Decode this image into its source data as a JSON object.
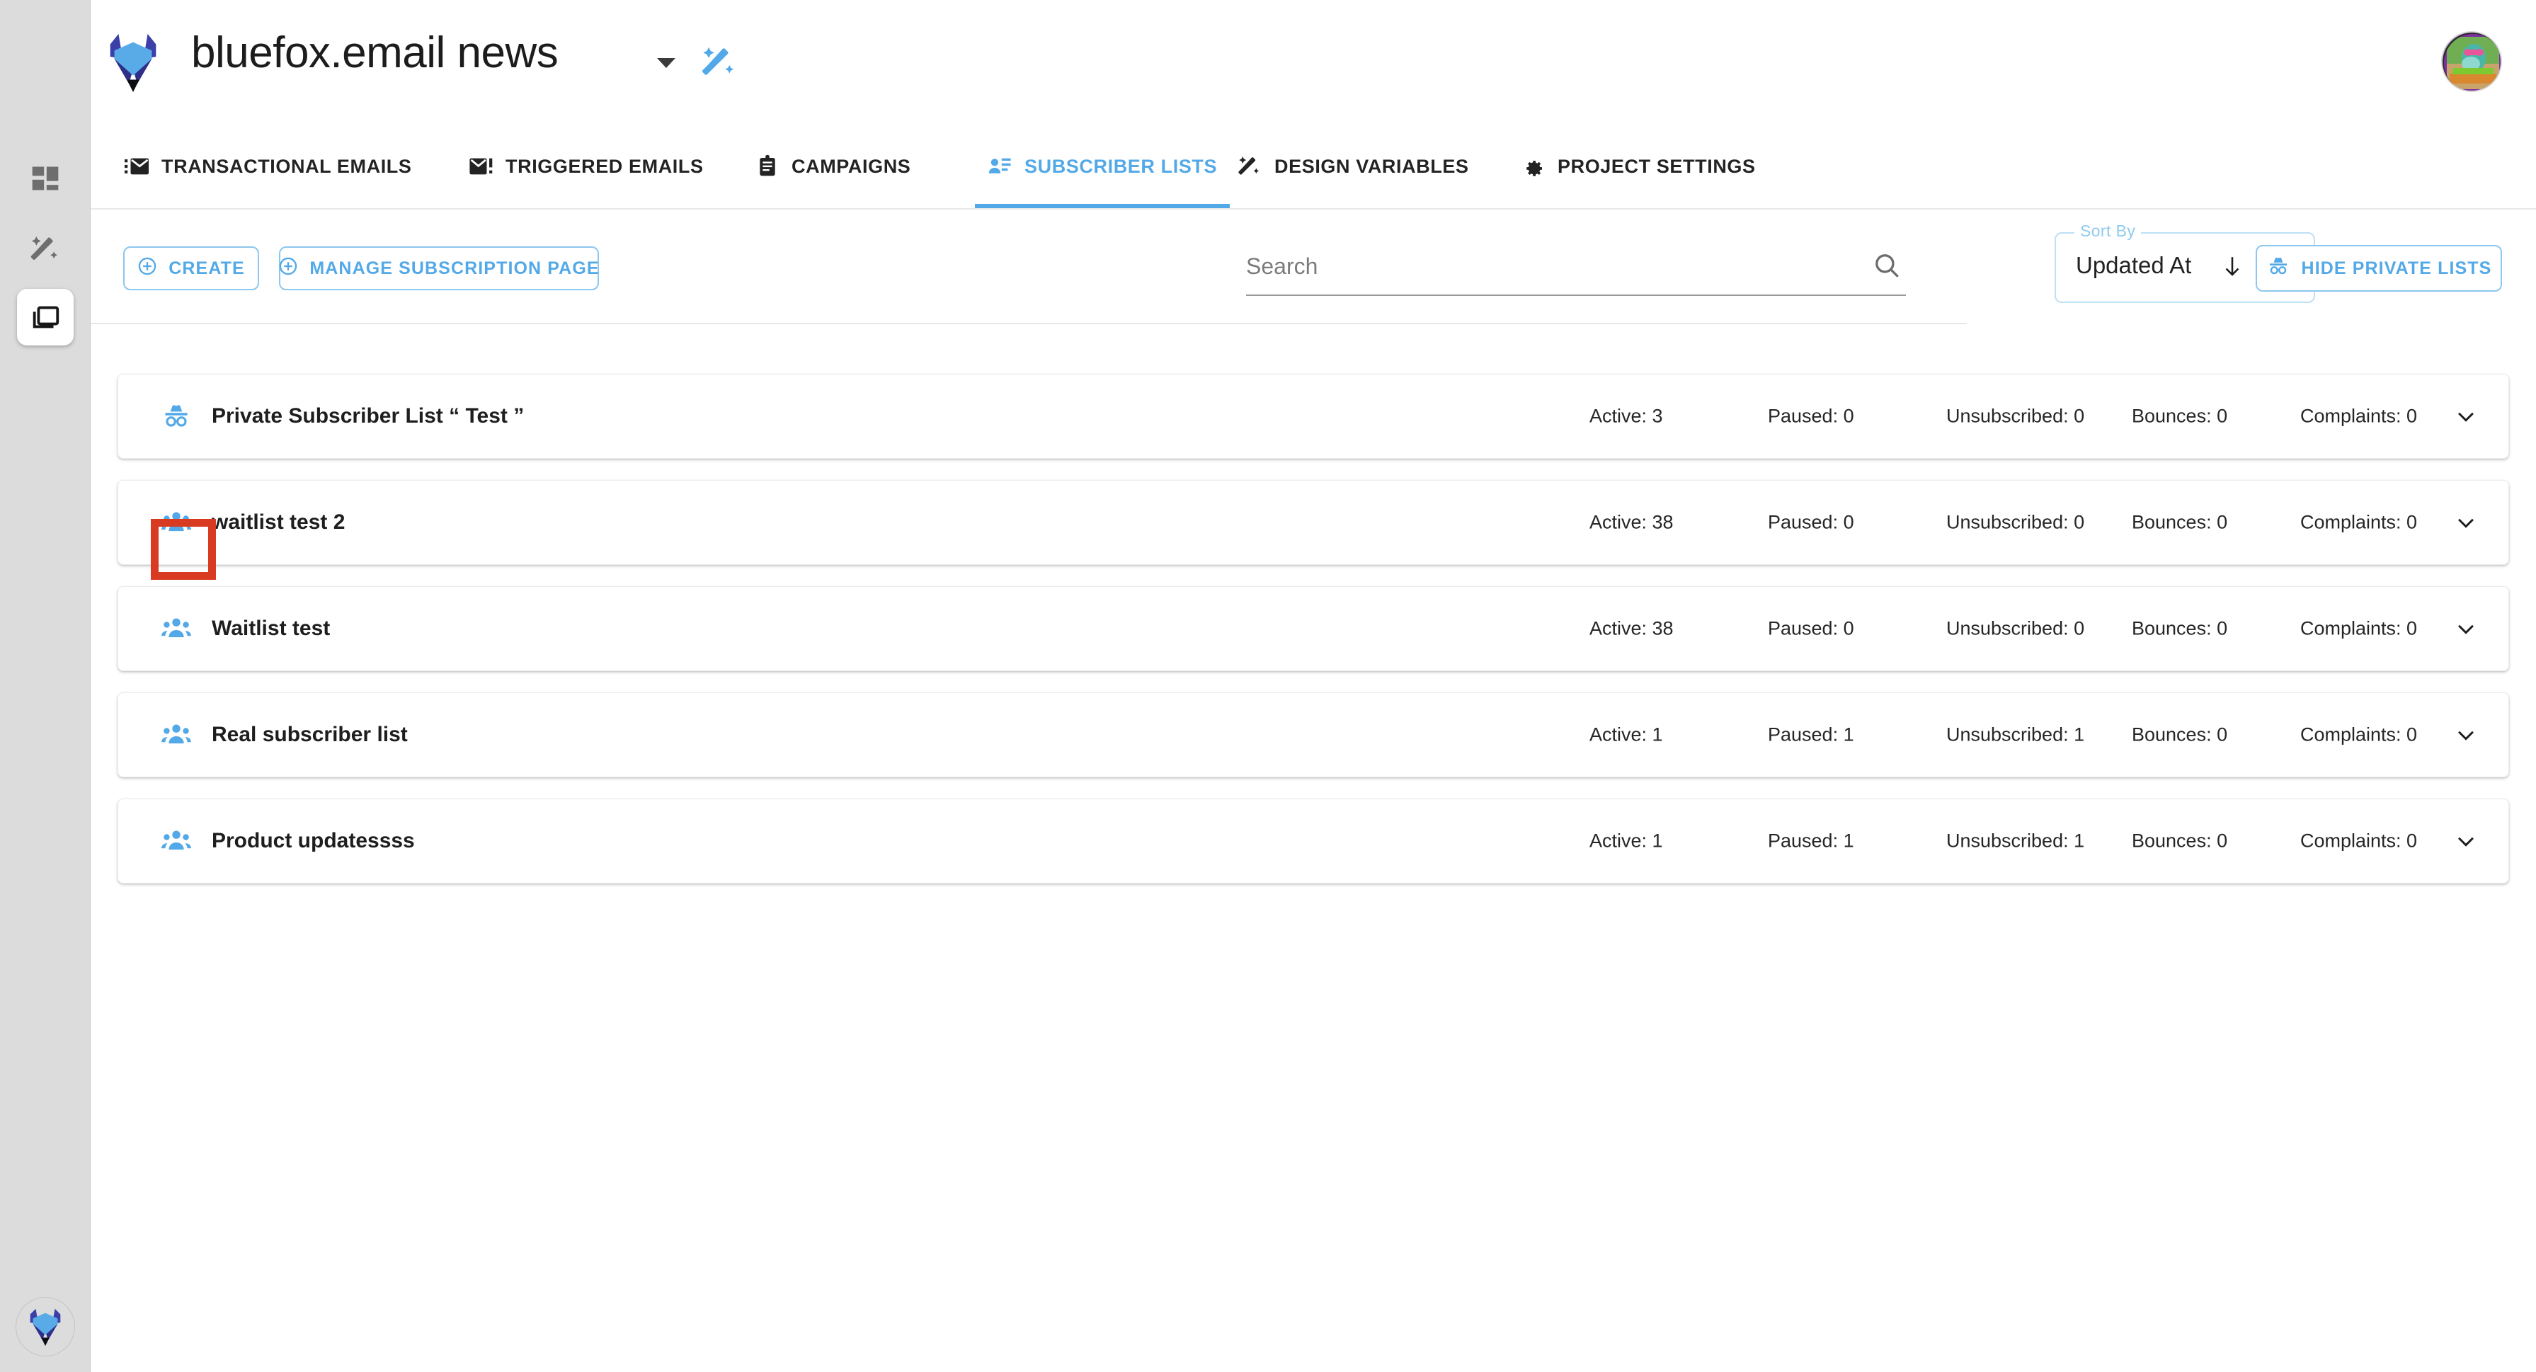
{
  "colors": {
    "accent": "#53a9e8",
    "accent_light": "#8cc7ef",
    "highlight": "#d93b22",
    "text": "#1e1e1e",
    "rail_bg": "#dcdcdc"
  },
  "left_rail": {
    "items": [
      {
        "name": "dashboard",
        "icon": "dashboard-grid-icon",
        "active": false
      },
      {
        "name": "design",
        "icon": "magic-wand-icon",
        "active": false
      },
      {
        "name": "projects",
        "icon": "copy-folder-icon",
        "active": true
      }
    ],
    "bottom_logo": "bluefox-logo-icon"
  },
  "header": {
    "logo": "bluefox-logo-icon",
    "project_title": "bluefox.email news",
    "project_caret": "chevron-down-icon",
    "design_icon": "magic-wand-icon",
    "avatar": "user-avatar"
  },
  "tabs": [
    {
      "id": "transactional",
      "label": "TRANSACTIONAL EMAILS",
      "icon": "transactional-email-icon",
      "active": false
    },
    {
      "id": "triggered",
      "label": "TRIGGERED EMAILS",
      "icon": "triggered-email-icon",
      "active": false
    },
    {
      "id": "campaigns",
      "label": "CAMPAIGNS",
      "icon": "campaign-icon",
      "active": false
    },
    {
      "id": "subscriber",
      "label": "SUBSCRIBER LISTS",
      "icon": "subscriber-list-icon",
      "active": true
    },
    {
      "id": "design",
      "label": "DESIGN VARIABLES",
      "icon": "magic-wand-icon",
      "active": false
    },
    {
      "id": "settings",
      "label": "PROJECT SETTINGS",
      "icon": "gear-icon",
      "active": false
    }
  ],
  "toolbar": {
    "create_label": "CREATE",
    "manage_subscription_label": "MANAGE SUBSCRIPTION PAGE",
    "hide_private_label": "HIDE PRIVATE LISTS",
    "hide_private_icon": "incognito-icon",
    "search": {
      "value": "",
      "placeholder": "Search",
      "icon": "search-icon"
    },
    "sort_by": {
      "legend": "Sort By",
      "value": "Updated At",
      "direction_icon": "arrow-down-icon",
      "caret_icon": "chevron-down-icon"
    }
  },
  "list": {
    "stat_labels": [
      "Active",
      "Paused",
      "Unsubscribed",
      "Bounces",
      "Complaints"
    ],
    "rows": [
      {
        "title": "Private Subscriber List “ Test ”",
        "icon": "incognito-icon",
        "private": true,
        "highlighted": false,
        "stats": {
          "active": "Active: 3",
          "paused": "Paused: 0",
          "unsubscribed": "Unsubscribed: 0",
          "bounces": "Bounces: 0",
          "complaints": "Complaints: 0"
        }
      },
      {
        "title": "waitlist test 2",
        "icon": "group-people-icon",
        "private": false,
        "highlighted": true,
        "stats": {
          "active": "Active: 38",
          "paused": "Paused: 0",
          "unsubscribed": "Unsubscribed: 0",
          "bounces": "Bounces: 0",
          "complaints": "Complaints: 0"
        }
      },
      {
        "title": "Waitlist test",
        "icon": "group-people-icon",
        "private": false,
        "highlighted": false,
        "stats": {
          "active": "Active: 38",
          "paused": "Paused: 0",
          "unsubscribed": "Unsubscribed: 0",
          "bounces": "Bounces: 0",
          "complaints": "Complaints: 0"
        }
      },
      {
        "title": "Real subscriber list",
        "icon": "group-people-icon",
        "private": false,
        "highlighted": false,
        "stats": {
          "active": "Active: 1",
          "paused": "Paused: 1",
          "unsubscribed": "Unsubscribed: 1",
          "bounces": "Bounces: 0",
          "complaints": "Complaints: 0"
        }
      },
      {
        "title": "Product updatessss",
        "icon": "group-people-icon",
        "private": false,
        "highlighted": false,
        "stats": {
          "active": "Active: 1",
          "paused": "Paused: 1",
          "unsubscribed": "Unsubscribed: 1",
          "bounces": "Bounces: 0",
          "complaints": "Complaints: 0"
        }
      }
    ]
  }
}
